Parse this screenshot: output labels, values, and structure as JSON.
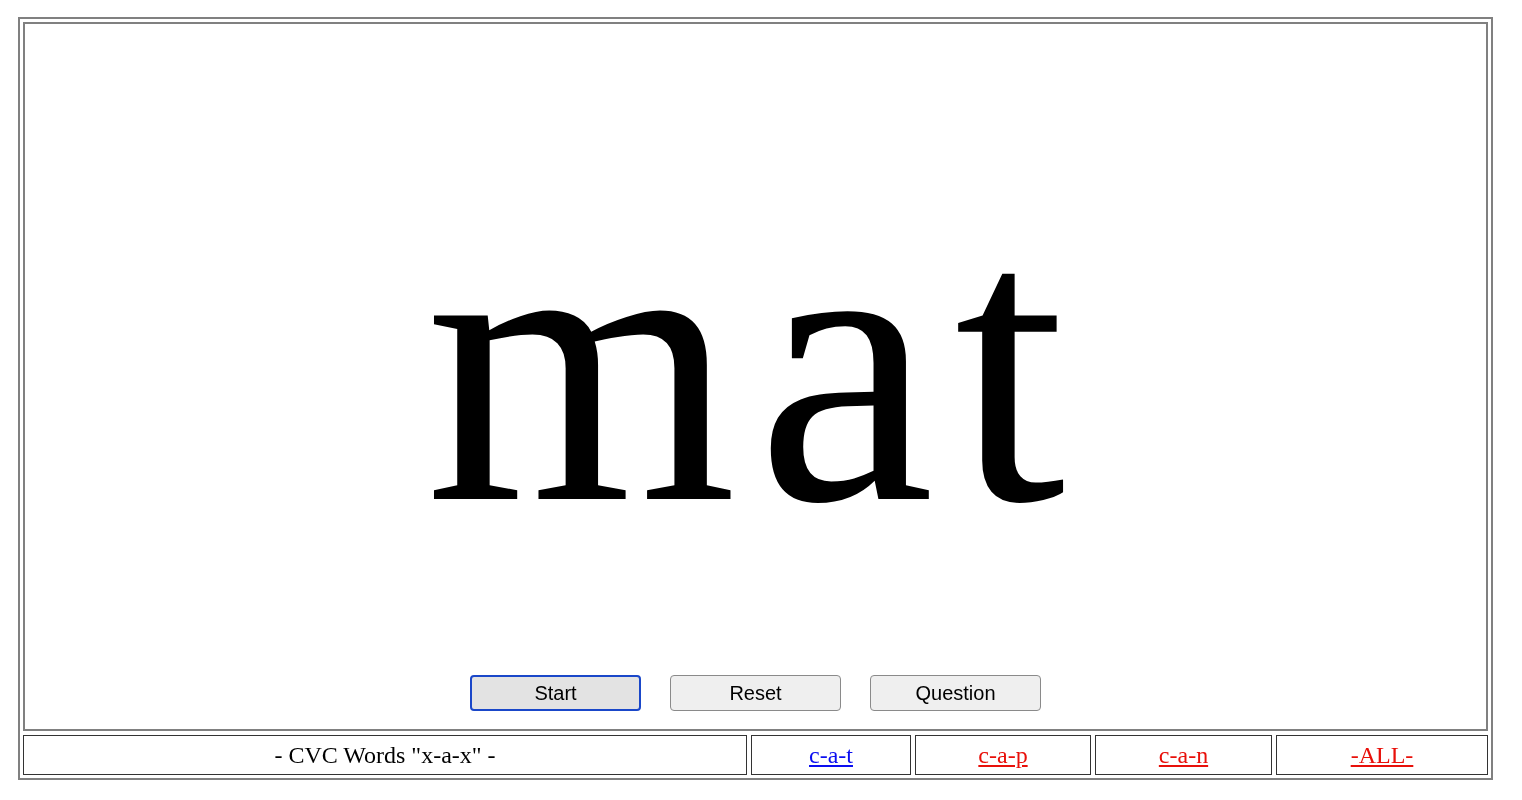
{
  "word": "mat",
  "buttons": [
    {
      "label": "Start",
      "focused": true
    },
    {
      "label": "Reset",
      "focused": false
    },
    {
      "label": "Question",
      "focused": false
    }
  ],
  "footer": {
    "title": "- CVC Words \"x-a-x\" -",
    "links": [
      {
        "label": "c-a-t",
        "selected": true
      },
      {
        "label": "c-a-p",
        "selected": false
      },
      {
        "label": "c-a-n",
        "selected": false
      },
      {
        "label": "-ALL-",
        "selected": false
      }
    ]
  }
}
